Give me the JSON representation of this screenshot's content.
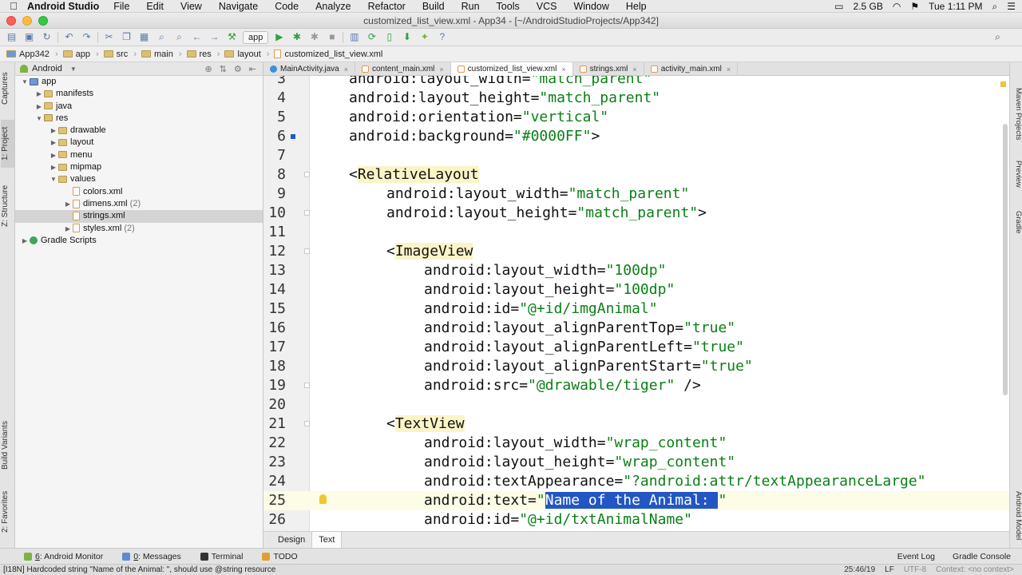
{
  "menubar": {
    "app": "Android Studio",
    "items": [
      "File",
      "Edit",
      "View",
      "Navigate",
      "Code",
      "Analyze",
      "Refactor",
      "Build",
      "Run",
      "Tools",
      "VCS",
      "Window",
      "Help"
    ],
    "memory": "2.5 GB",
    "clock": "Tue 1:11 PM"
  },
  "window_title": "customized_list_view.xml - App34 - [~/AndroidStudioProjects/App342]",
  "toolbar": {
    "run_config": "app"
  },
  "breadcrumb": [
    "App342",
    "app",
    "src",
    "main",
    "res",
    "layout",
    "customized_list_view.xml"
  ],
  "project_panel": {
    "view_mode": "Android",
    "tree": [
      {
        "label": "app",
        "depth": 0,
        "expanded": true,
        "kind": "mod"
      },
      {
        "label": "manifests",
        "depth": 1,
        "expanded": false,
        "kind": "dir"
      },
      {
        "label": "java",
        "depth": 1,
        "expanded": false,
        "kind": "dir"
      },
      {
        "label": "res",
        "depth": 1,
        "expanded": true,
        "kind": "res"
      },
      {
        "label": "drawable",
        "depth": 2,
        "expanded": false,
        "kind": "dir"
      },
      {
        "label": "layout",
        "depth": 2,
        "expanded": false,
        "kind": "dir"
      },
      {
        "label": "menu",
        "depth": 2,
        "expanded": false,
        "kind": "dir"
      },
      {
        "label": "mipmap",
        "depth": 2,
        "expanded": false,
        "kind": "dir"
      },
      {
        "label": "values",
        "depth": 2,
        "expanded": true,
        "kind": "dir"
      },
      {
        "label": "colors.xml",
        "depth": 3,
        "kind": "xml",
        "count": ""
      },
      {
        "label": "dimens.xml",
        "depth": 3,
        "expanded": false,
        "kind": "xml",
        "count": "(2)"
      },
      {
        "label": "strings.xml",
        "depth": 3,
        "kind": "xml",
        "count": "",
        "selected": true
      },
      {
        "label": "styles.xml",
        "depth": 3,
        "expanded": false,
        "kind": "xml",
        "count": "(2)"
      },
      {
        "label": "Gradle Scripts",
        "depth": 0,
        "expanded": false,
        "kind": "grad"
      }
    ]
  },
  "editor_tabs": [
    {
      "label": "MainActivity.java",
      "type": "j",
      "active": false
    },
    {
      "label": "content_main.xml",
      "type": "x",
      "active": false
    },
    {
      "label": "customized_list_view.xml",
      "type": "x",
      "active": true
    },
    {
      "label": "strings.xml",
      "type": "x",
      "active": false
    },
    {
      "label": "activity_main.xml",
      "type": "x",
      "active": false
    }
  ],
  "code_lines": [
    {
      "n": "3",
      "indent": 0,
      "attr": "android:layout_width=",
      "val": "\"match_parent\"",
      "tail": ""
    },
    {
      "n": "4",
      "indent": 0,
      "attr": "android:layout_height=",
      "val": "\"match_parent\"",
      "tail": ""
    },
    {
      "n": "5",
      "indent": 0,
      "attr": "android:orientation=",
      "val": "\"vertical\"",
      "tail": ""
    },
    {
      "n": "6",
      "indent": 0,
      "attr": "android:background=",
      "val": "\"#0000FF\"",
      "tail": ">"
    },
    {
      "n": "7",
      "indent": 0,
      "attr": "",
      "val": "",
      "tail": ""
    },
    {
      "n": "8",
      "indent": 0,
      "open": "<",
      "tag": "RelativeLayout",
      "attr": "",
      "val": "",
      "tail": ""
    },
    {
      "n": "9",
      "indent": 1,
      "attr": "android:layout_width=",
      "val": "\"match_parent\"",
      "tail": ""
    },
    {
      "n": "10",
      "indent": 1,
      "attr": "android:layout_height=",
      "val": "\"match_parent\"",
      "tail": ">"
    },
    {
      "n": "11",
      "indent": 0,
      "attr": "",
      "val": "",
      "tail": ""
    },
    {
      "n": "12",
      "indent": 1,
      "open": "<",
      "tag": "ImageView",
      "attr": "",
      "val": "",
      "tail": ""
    },
    {
      "n": "13",
      "indent": 2,
      "attr": "android:layout_width=",
      "val": "\"100dp\"",
      "tail": ""
    },
    {
      "n": "14",
      "indent": 2,
      "attr": "android:layout_height=",
      "val": "\"100dp\"",
      "tail": ""
    },
    {
      "n": "15",
      "indent": 2,
      "attr": "android:id=",
      "val": "\"@+id/imgAnimal\"",
      "tail": ""
    },
    {
      "n": "16",
      "indent": 2,
      "attr": "android:layout_alignParentTop=",
      "val": "\"true\"",
      "tail": ""
    },
    {
      "n": "17",
      "indent": 2,
      "attr": "android:layout_alignParentLeft=",
      "val": "\"true\"",
      "tail": ""
    },
    {
      "n": "18",
      "indent": 2,
      "attr": "android:layout_alignParentStart=",
      "val": "\"true\"",
      "tail": ""
    },
    {
      "n": "19",
      "indent": 2,
      "attr": "android:src=",
      "val": "\"@drawable/tiger\"",
      "tail": " />"
    },
    {
      "n": "20",
      "indent": 0,
      "attr": "",
      "val": "",
      "tail": ""
    },
    {
      "n": "21",
      "indent": 1,
      "open": "<",
      "tag": "TextView",
      "attr": "",
      "val": "",
      "tail": ""
    },
    {
      "n": "22",
      "indent": 2,
      "attr": "android:layout_width=",
      "val": "\"wrap_content\"",
      "tail": ""
    },
    {
      "n": "23",
      "indent": 2,
      "attr": "android:layout_height=",
      "val": "\"wrap_content\"",
      "tail": ""
    },
    {
      "n": "24",
      "indent": 2,
      "attr": "android:textAppearance=",
      "val": "\"?android:attr/textAppearanceLarge\"",
      "tail": ""
    },
    {
      "n": "25",
      "indent": 2,
      "attr": "android:text=",
      "val": "\"",
      "sel": "Name of the Animal: ",
      "val2": "\"",
      "tail": "",
      "current": true
    },
    {
      "n": "26",
      "indent": 2,
      "attr": "android:id=",
      "val": "\"@+id/txtAnimalName\"",
      "tail": ""
    }
  ],
  "view_tabs": [
    "Design",
    "Text"
  ],
  "tool_windows": [
    {
      "num": "6",
      "label": ": Android Monitor",
      "color": "#7cb342"
    },
    {
      "num": "0",
      "label": ": Messages",
      "color": "#5b8bd0"
    },
    {
      "num": "",
      "label": "Terminal",
      "color": "#333333"
    },
    {
      "num": "",
      "label": "TODO",
      "color": "#e0a030"
    }
  ],
  "tool_windows_right": [
    "Event Log",
    "Gradle Console"
  ],
  "left_vtabs": [
    "Captures",
    "1: Project",
    "Z: Structure",
    "Build Variants",
    "2: Favorites"
  ],
  "right_vtabs": [
    "Maven Projects",
    "Preview",
    "Gradle",
    "Android Model"
  ],
  "status": {
    "message": "[I18N] Hardcoded string \"Name of the Animal: \", should use @string resource",
    "position": "25:46/19",
    "line_sep": "LF",
    "encoding": "UTF-8",
    "context": "Context: <no context>"
  }
}
